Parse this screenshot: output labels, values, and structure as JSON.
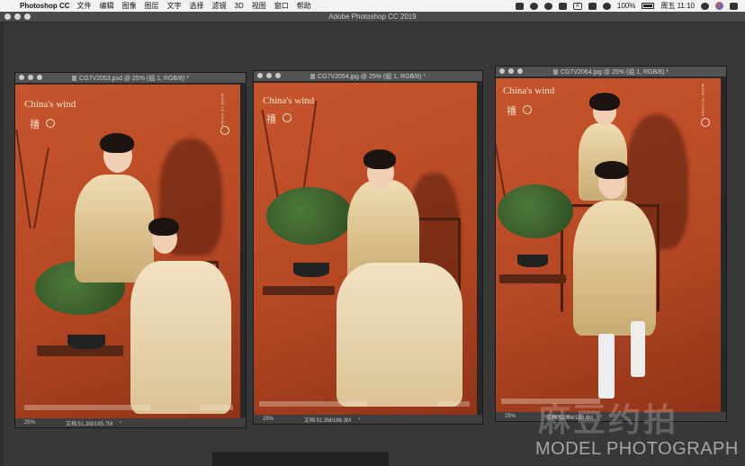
{
  "menubar": {
    "apple_icon": "apple-icon",
    "app_name": "Photoshop CC",
    "items": [
      "文件",
      "编辑",
      "图像",
      "图层",
      "文字",
      "选择",
      "滤镜",
      "3D",
      "视图",
      "窗口",
      "帮助"
    ],
    "battery": "100%",
    "clock": "周五 11:10"
  },
  "app": {
    "title": "Adobe Photoshop CC 2019"
  },
  "documents": [
    {
      "title": "CG7V2053.psd @ 25% (组 1, RGB/8) *",
      "zoom": "25%",
      "doc_info": "文档:51.3M/185.7M",
      "brand": "China's wind",
      "seal": "禧",
      "vertical_text": "MADE IN CHINA"
    },
    {
      "title": "CG7V2054.jpg @ 25% (组 1, RGB/8) *",
      "zoom": "25%",
      "doc_info": "文档:51.3M/186.3M",
      "brand": "China's wind",
      "seal": "禧",
      "vertical_text": "MADE IN CHINA"
    },
    {
      "title": "CG7V2064.jpg @ 25% (组 1, RGB/8) *",
      "zoom": "25%",
      "doc_info": "文档:51.3M/189.8M",
      "brand": "China's wind",
      "seal": "禧",
      "vertical_text": "MADE IN CHINA"
    }
  ],
  "watermark": {
    "cn": "麻豆约拍",
    "en": "MODEL PHOTOGRAPH"
  },
  "colors": {
    "backdrop": "#c6552d",
    "workspace": "#383838",
    "menubar": "#f2f2f2"
  }
}
